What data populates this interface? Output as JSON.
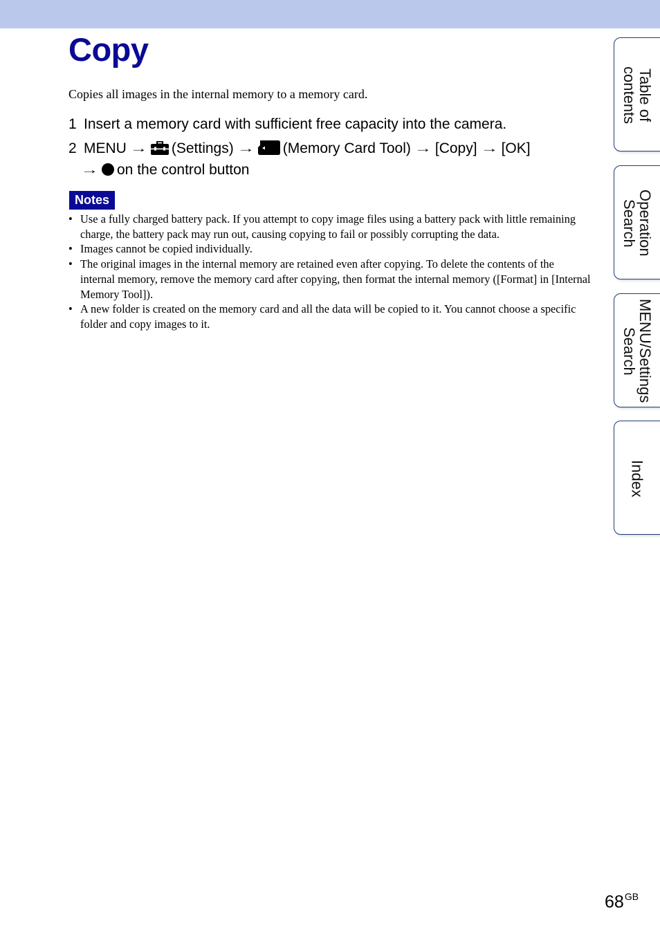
{
  "header": {
    "band_color": "#b9c8eb"
  },
  "page": {
    "title": "Copy",
    "title_color": "#0a0a96",
    "intro": "Copies all images in the internal memory to a memory card."
  },
  "steps": [
    {
      "number": "1",
      "text": "Insert a memory card with sufficient free capacity into the camera."
    },
    {
      "number": "2",
      "parts": {
        "menu": "MENU",
        "settings_icon": "toolbox-settings-icon",
        "settings": "(Settings)",
        "card_icon": "memory-card-icon",
        "card_tool": "(Memory Card Tool)",
        "copy": "[Copy]",
        "ok": "[OK]",
        "circle_icon": "filled-circle-icon",
        "control": "on the control button"
      },
      "arrow": "→"
    }
  ],
  "notes": {
    "badge": "Notes",
    "items": [
      "Use a fully charged battery pack. If you attempt to copy image files using a battery pack with little remaining charge, the battery pack may run out, causing copying to fail or possibly corrupting the data.",
      "Images cannot be copied individually.",
      "The original images in the internal memory are retained even after copying. To delete the contents of the internal memory, remove the memory card after copying, then format the internal memory ([Format] in [Internal Memory Tool]).",
      "A new folder is created on the memory card and all the data will be copied to it. You cannot choose a specific folder and copy images to it."
    ]
  },
  "side_tabs": [
    {
      "label": "Table of\ncontents"
    },
    {
      "label": "Operation\nSearch"
    },
    {
      "label": "MENU/Settings\nSearch"
    },
    {
      "label": "Index"
    }
  ],
  "footer": {
    "page_number": "68",
    "page_suffix": "GB"
  }
}
